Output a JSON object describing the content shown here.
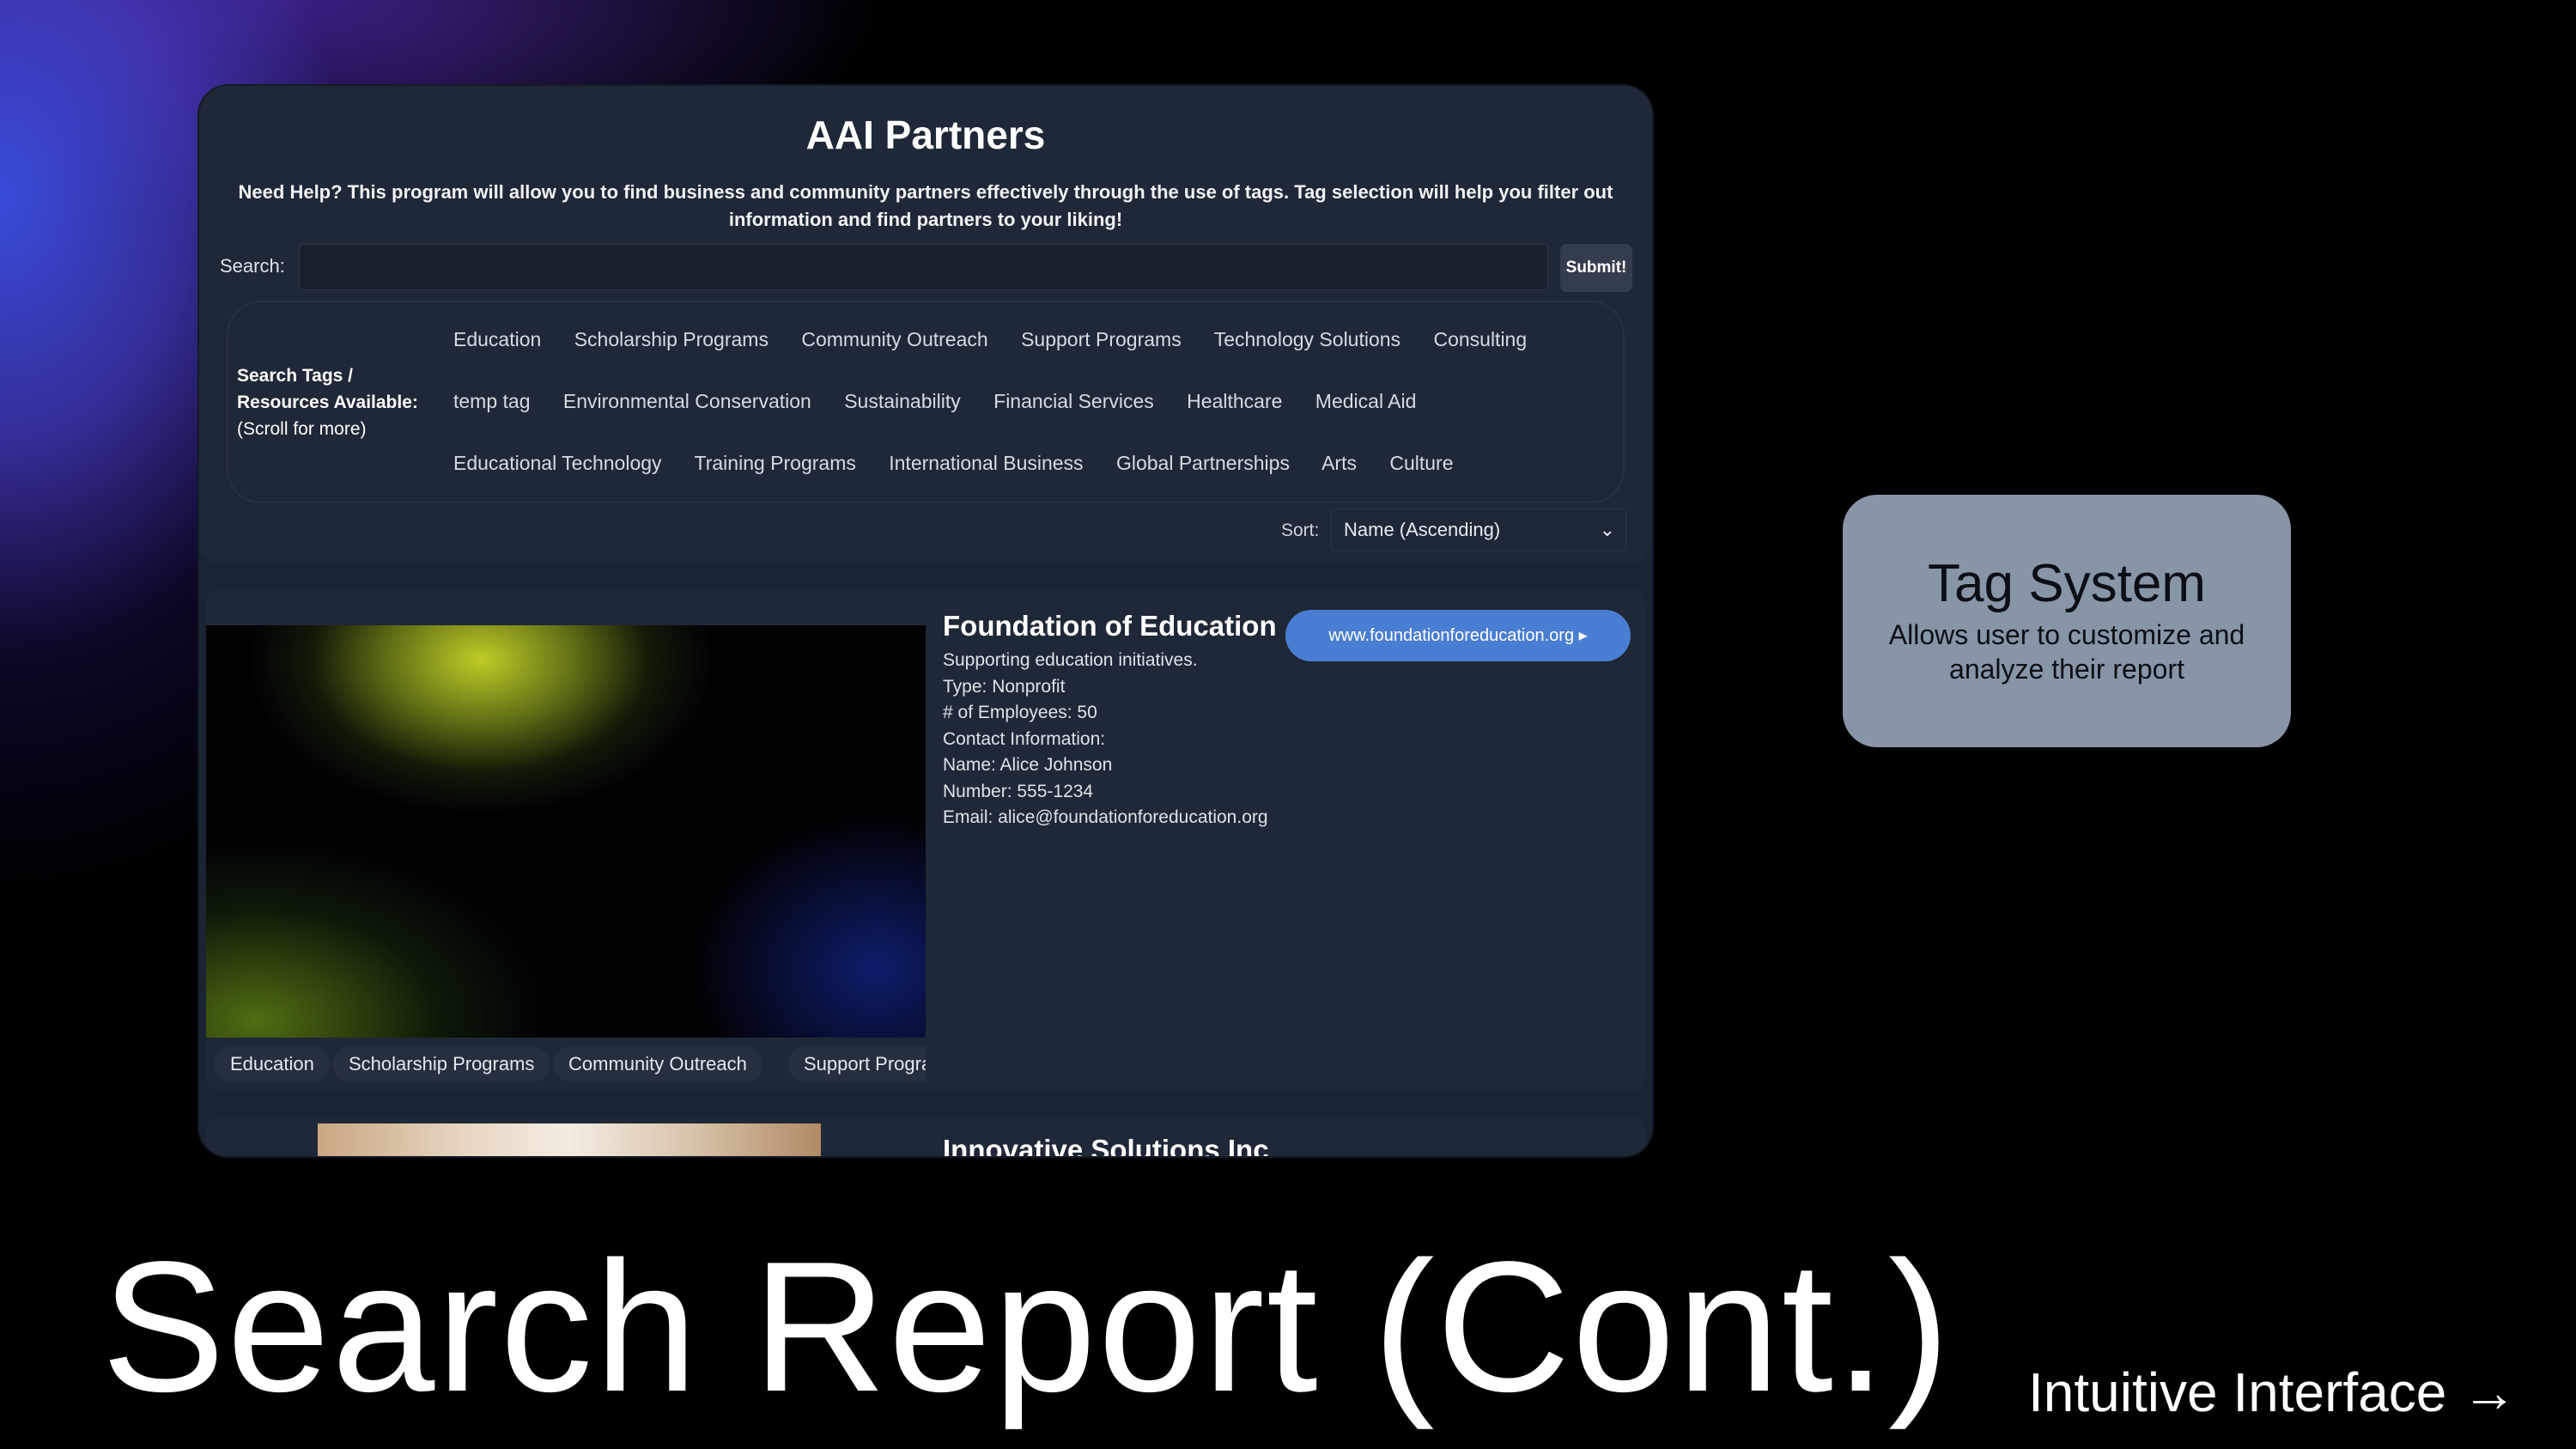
{
  "app": {
    "title": "AAI Partners",
    "help_text": "Need Help? This program will allow you to find business and community partners effectively through the use of tags. Tag selection will help you filter out information and find partners to your liking!"
  },
  "search": {
    "label": "Search:",
    "value": "",
    "placeholder": "",
    "submit_label": "Submit!"
  },
  "tags": {
    "label_line1": "Search Tags /",
    "label_line2": "Resources Available:",
    "label_hint": "(Scroll for more)",
    "rows": [
      [
        "Education",
        "Scholarship Programs",
        "Community Outreach",
        "Support Programs",
        "Technology Solutions",
        "Consulting"
      ],
      [
        "temp tag",
        "Environmental Conservation",
        "Sustainability",
        "Financial Services",
        "Healthcare",
        "Medical Aid"
      ],
      [
        "Educational Technology",
        "Training Programs",
        "International Business",
        "Global Partnerships",
        "Arts",
        "Culture"
      ]
    ]
  },
  "sort": {
    "label": "Sort:",
    "selected": "Name (Ascending)"
  },
  "results": [
    {
      "name": "Foundation of Education",
      "description": "Supporting education initiatives.",
      "type": "Type: Nonprofit",
      "employees": "# of Employees: 50",
      "contact_header": "Contact Information:",
      "contact_name": "Name: Alice Johnson",
      "contact_number": "Number: 555-1234",
      "contact_email": "Email: alice@foundationforeducation.org",
      "tags": [
        "Education",
        "Scholarship Programs",
        "Community Outreach",
        "Support Progra"
      ],
      "website_label": "www.foundationforeducation.org ▸"
    },
    {
      "name": "Innovative Solutions Inc"
    }
  ],
  "callout": {
    "title": "Tag System",
    "description": "Allows user to customize and analyze their report"
  },
  "slide": {
    "title": "Search Report (Cont.)",
    "next_label": "Intuitive Interface →"
  }
}
